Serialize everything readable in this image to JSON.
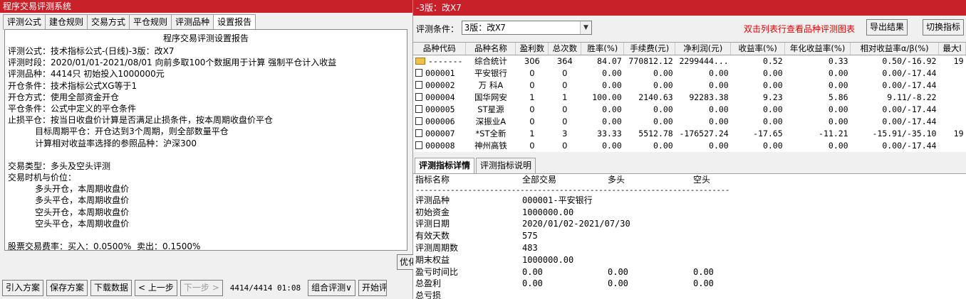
{
  "left": {
    "title": "程序交易评测系统",
    "tabs": [
      "评测公式",
      "建仓规则",
      "交易方式",
      "平仓规则",
      "评测品种",
      "设置报告"
    ],
    "active_tab": 5,
    "report": {
      "title": "程序交易评测设置报告",
      "lines": [
        "评测公式：技术指标公式-(日线)-3版：改X7",
        "评测时段：2020/01/01-2021/08/01 向前多取100个数据用于计算 强制平仓计入收益",
        "评测品种：4414只 初始投入1000000元",
        "开仓条件：技术指标公式XG等于1",
        "开仓方式：使用全部资金开仓",
        "平仓条件：公式中定义的平仓条件",
        "止损平仓：按当日收盘价计算是否满足止损条件，按本周期收盘价平仓",
        "          目标周期平仓：开仓达到3个周期，则全部数量平仓",
        "          计算相对收益率选择的参照品种：沪深300",
        "",
        "交易类型：多头及空头评测",
        "交易时机与价位：",
        "          多头开仓，本周期收盘价",
        "          多头平仓，本周期收盘价",
        "          空头开仓，本周期收盘价",
        "          空头平仓，本周期收盘价",
        "",
        "股票交易费率：买入：0.0500%  卖出：0.1500%"
      ]
    },
    "optimize_label": "优化",
    "buttons": {
      "import": "引入方案",
      "save": "保存方案",
      "download": "下载数据",
      "prev": "< 上一步",
      "next": "下一步 >",
      "combo": "组合评测∨",
      "start": "开始评测"
    },
    "status_count": "4414/4414 01:08"
  },
  "right": {
    "title": "-3版：改X7",
    "condition_label": "评测条件：",
    "condition_value": "3版：改X7",
    "hint": "双击列表行查看品种评测图表",
    "export_label": "导出结果",
    "switch_label": "切换指标",
    "columns": [
      "品种代码",
      "品种名称",
      "盈利数",
      "总次数",
      "胜率(%)",
      "手续费(元)",
      "净利润(元)",
      "收益率(%)",
      "年化收益率(%)",
      "相对收益率α/β(%)",
      "最大l"
    ],
    "rows": [
      [
        "-------",
        "综合统计",
        "306",
        "364",
        "84.07",
        "770812.12",
        "2299444...",
        "0.52",
        "0.33",
        "0.50/-16.92",
        "19"
      ],
      [
        "000001",
        "平安银行",
        "0",
        "0",
        "0.00",
        "0.00",
        "0.00",
        "0.00",
        "0.00",
        "0.00/-17.44",
        ""
      ],
      [
        "000002",
        "万 科A",
        "0",
        "0",
        "0.00",
        "0.00",
        "0.00",
        "0.00",
        "0.00",
        "0.00/-17.44",
        ""
      ],
      [
        "000004",
        "国华网安",
        "1",
        "1",
        "100.00",
        "2140.63",
        "92283.38",
        "9.23",
        "5.86",
        "9.11/-8.22",
        ""
      ],
      [
        "000005",
        "ST星源",
        "0",
        "0",
        "0.00",
        "0.00",
        "0.00",
        "0.00",
        "0.00",
        "0.00/-17.44",
        ""
      ],
      [
        "000006",
        "深振业A",
        "0",
        "0",
        "0.00",
        "0.00",
        "0.00",
        "0.00",
        "0.00",
        "0.00/-17.44",
        ""
      ],
      [
        "000007",
        "*ST全新",
        "1",
        "3",
        "33.33",
        "5512.78",
        "-176527.24",
        "-17.65",
        "-11.21",
        "-15.91/-35.10",
        "19"
      ],
      [
        "000008",
        "神州高铁",
        "0",
        "0",
        "0.00",
        "0.00",
        "0.00",
        "0.00",
        "0.00",
        "0.00/-17.44",
        ""
      ]
    ],
    "detail_tabs": [
      "评测指标详情",
      "评测指标说明"
    ],
    "detail_header": [
      "指标名称",
      "全部交易",
      "多头",
      "空头"
    ],
    "detail_rows": [
      [
        "评测品种",
        "000001-平安银行",
        "",
        ""
      ],
      [
        "初始资金",
        "1000000.00",
        "",
        ""
      ],
      [
        "评测日期",
        "2020/01/02-2021/07/30",
        "",
        ""
      ],
      [
        "有效天数",
        "575",
        "",
        ""
      ],
      [
        "评测周期数",
        "483",
        "",
        ""
      ],
      [
        "期末权益",
        "1000000.00",
        "",
        ""
      ],
      [
        "盈亏时间比",
        "0.00",
        "0.00",
        "0.00"
      ],
      [
        "总盈利",
        "0.00",
        "0.00",
        "0.00"
      ],
      [
        "总亏损",
        "",
        "",
        ""
      ]
    ]
  }
}
